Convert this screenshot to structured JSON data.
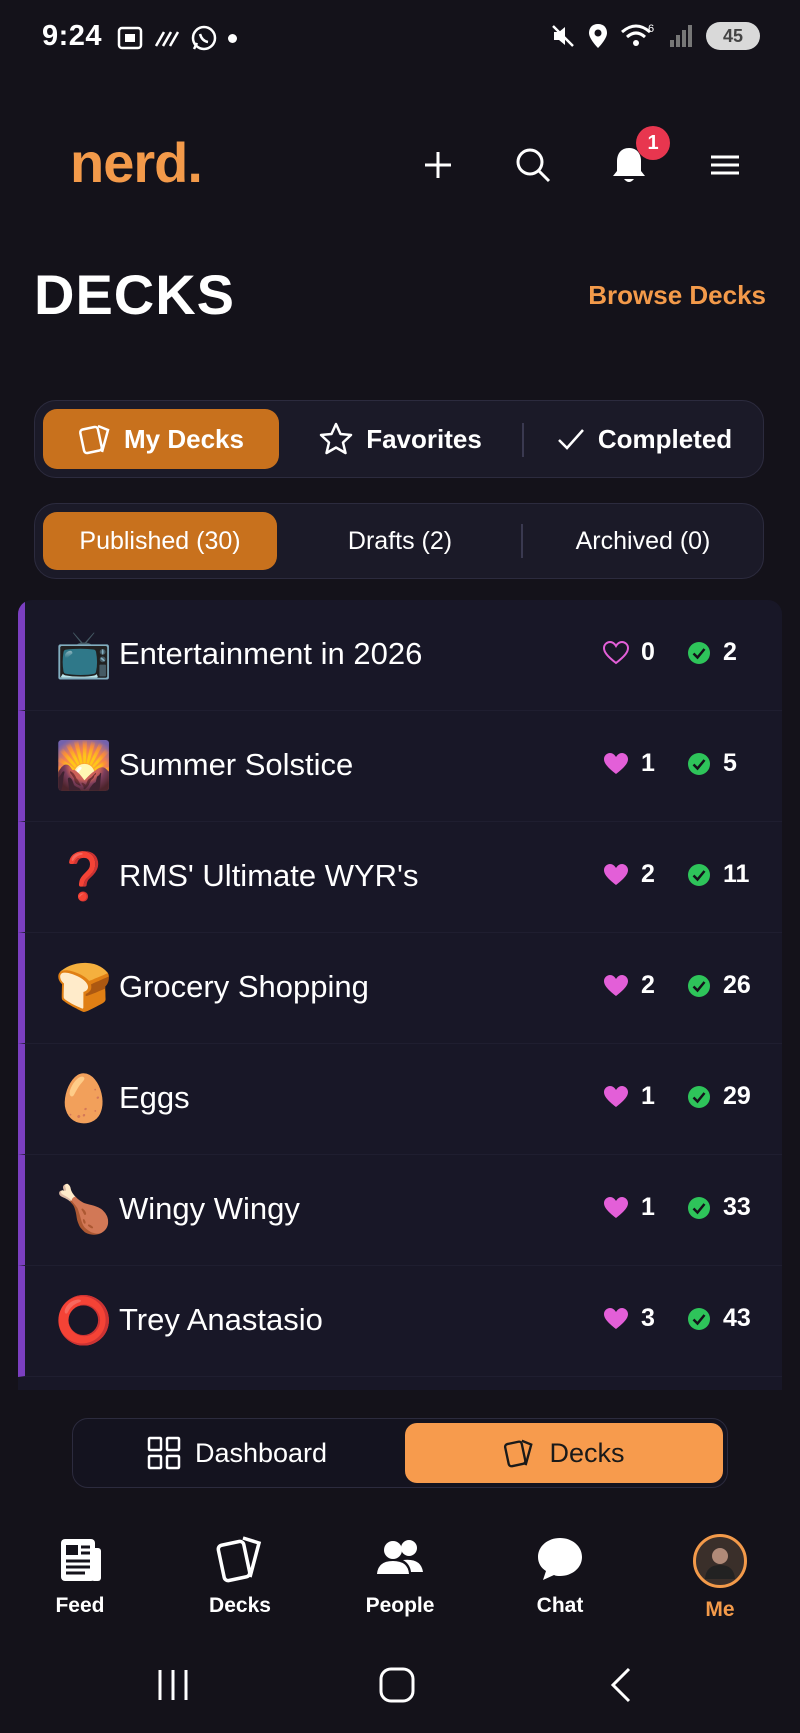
{
  "status": {
    "time": "9:24",
    "battery": "45",
    "wifi_label": "6"
  },
  "header": {
    "logo": "nerd.",
    "notification_count": "1"
  },
  "page": {
    "title": "DECKS",
    "browse_link": "Browse Decks"
  },
  "primary_tabs": [
    {
      "label": "My Decks",
      "active": true
    },
    {
      "label": "Favorites",
      "active": false
    },
    {
      "label": "Completed",
      "active": false
    }
  ],
  "secondary_tabs": [
    {
      "label": "Published (30)",
      "active": true
    },
    {
      "label": "Drafts (2)",
      "active": false
    },
    {
      "label": "Archived (0)",
      "active": false
    }
  ],
  "decks": [
    {
      "emoji": "📺",
      "title": "Entertainment in 2026",
      "likes": "0",
      "liked": false,
      "completions": "2"
    },
    {
      "emoji": "🌄",
      "title": "Summer Solstice",
      "likes": "1",
      "liked": true,
      "completions": "5"
    },
    {
      "emoji": "❓",
      "title": "RMS' Ultimate WYR's",
      "likes": "2",
      "liked": true,
      "completions": "11"
    },
    {
      "emoji": "🍞",
      "title": "Grocery Shopping",
      "likes": "2",
      "liked": true,
      "completions": "26"
    },
    {
      "emoji": "🥚",
      "title": "Eggs",
      "likes": "1",
      "liked": true,
      "completions": "29"
    },
    {
      "emoji": "🍗",
      "title": "Wingy Wingy",
      "likes": "1",
      "liked": true,
      "completions": "33"
    },
    {
      "emoji": "⭕",
      "title": "Trey Anastasio",
      "likes": "3",
      "liked": true,
      "completions": "43"
    }
  ],
  "bottom_switch": [
    {
      "label": "Dashboard",
      "active": false
    },
    {
      "label": "Decks",
      "active": true
    }
  ],
  "tabbar": [
    {
      "label": "Feed",
      "icon": "feed-icon"
    },
    {
      "label": "Decks",
      "icon": "decks-icon"
    },
    {
      "label": "People",
      "icon": "people-icon"
    },
    {
      "label": "Chat",
      "icon": "chat-icon"
    },
    {
      "label": "Me",
      "icon": "avatar",
      "active": true
    }
  ],
  "colors": {
    "accent": "#f39a4a",
    "accent_dark": "#c8711d",
    "heart": "#e35fd8",
    "check": "#2ec45a",
    "deck_stripe": "#7b3fc0",
    "background": "#14121a"
  }
}
